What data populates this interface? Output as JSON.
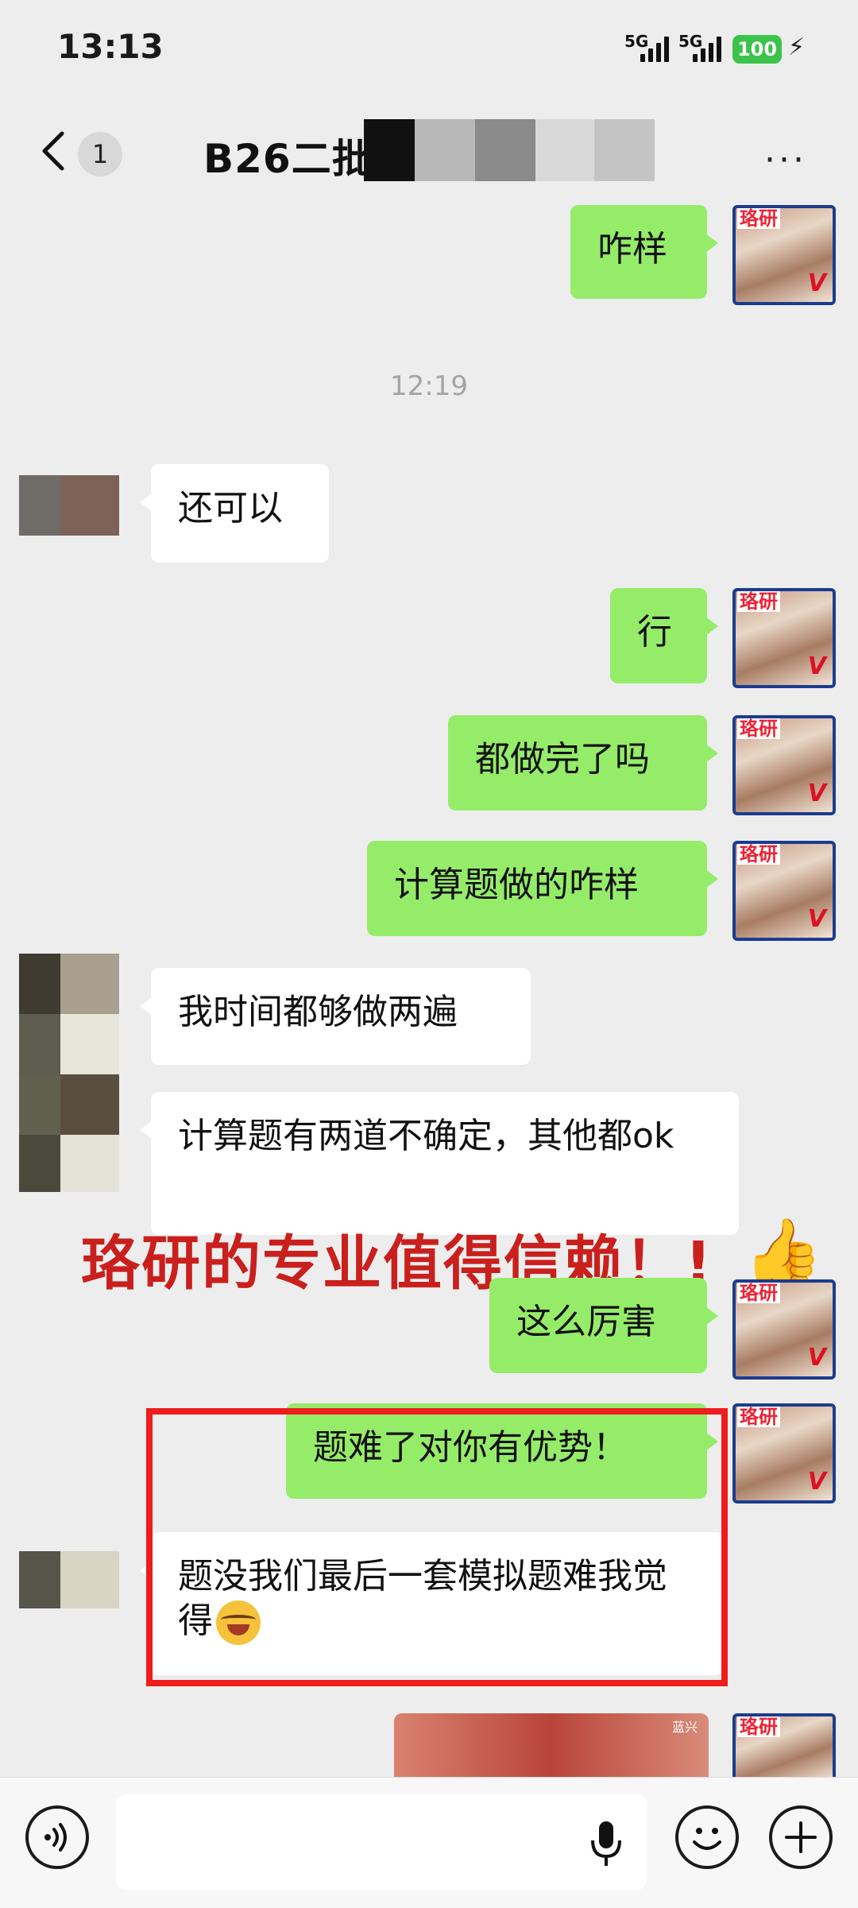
{
  "status_bar": {
    "time": "13:13",
    "signal1": "5G",
    "signal2": "5G",
    "battery": "100"
  },
  "nav": {
    "back_icon": "chevron-left-icon",
    "unread_count": "1",
    "title": "B26二批",
    "more_label": "···"
  },
  "messages": [
    {
      "side": "right",
      "text": "咋样"
    },
    {
      "side": "left",
      "text": "还可以"
    },
    {
      "side": "right",
      "text": "行"
    },
    {
      "side": "right",
      "text": "都做完了吗"
    },
    {
      "side": "right",
      "text": "计算题做的咋样"
    },
    {
      "side": "left",
      "text": "我时间都够做两遍"
    },
    {
      "side": "left",
      "text": "计算题有两道不确定，其他都ok"
    },
    {
      "side": "right",
      "text": "这么厉害"
    },
    {
      "side": "right",
      "text": "题难了对你有优势！"
    },
    {
      "side": "left",
      "text": "题没我们最后一套模拟题难我觉得"
    }
  ],
  "timestamp": "12:19",
  "overlay_caption": "珞研的专业值得信赖！!",
  "overlay_emoji": "👍",
  "avatar_tag": "珞研",
  "avatar_badge": "V",
  "image_msg_caption": "蓝兴",
  "bottom_bar": {
    "voice_icon": "voice-icon",
    "mic_icon": "mic-icon",
    "emoji_icon": "emoji-icon",
    "plus_icon": "plus-icon"
  },
  "colors": {
    "bubble_green": "#95ec69",
    "bubble_white": "#ffffff",
    "background": "#ededed",
    "caption_red": "#c9201e",
    "highlight_red": "#ee1c1c"
  }
}
